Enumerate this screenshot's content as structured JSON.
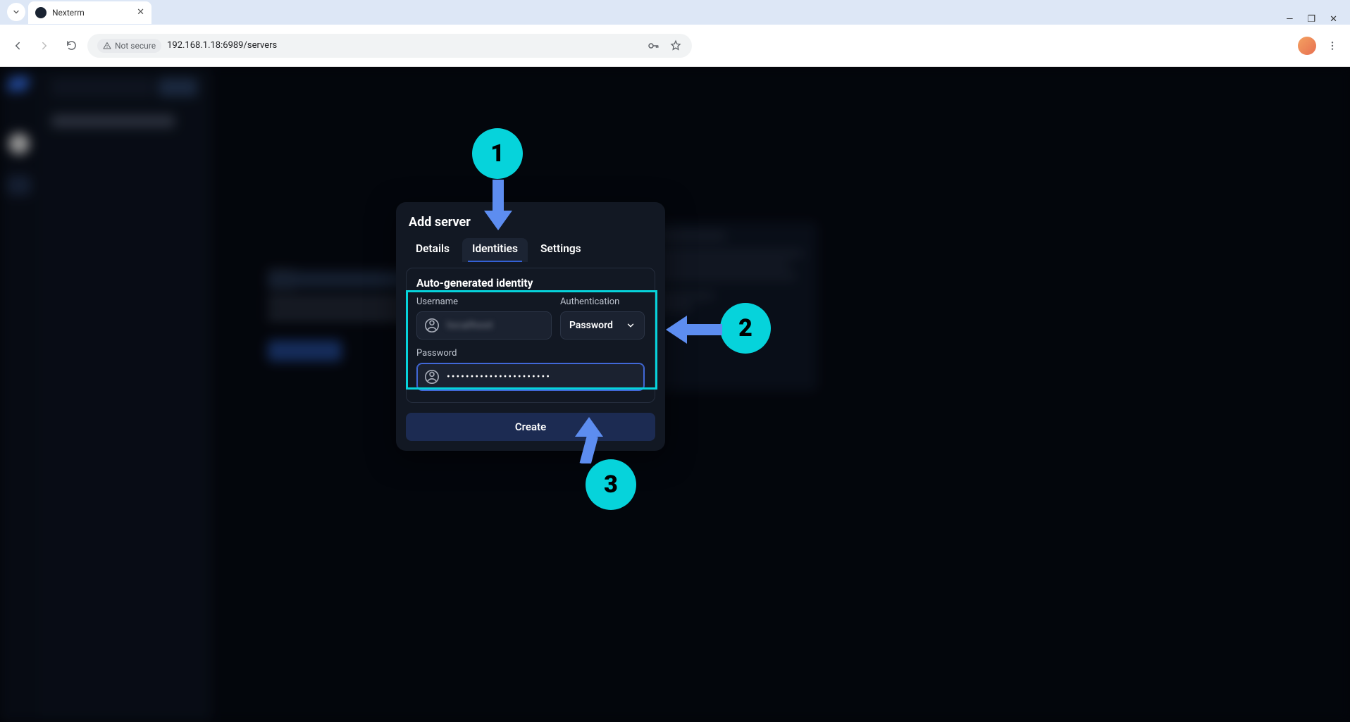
{
  "browser": {
    "tab_title": "Nexterm",
    "not_secure_label": "Not secure",
    "url": "192.168.1.18:6989/servers"
  },
  "modal": {
    "title": "Add server",
    "tabs": {
      "details": "Details",
      "identities": "Identities",
      "settings": "Settings"
    },
    "section_title": "Auto-generated identity",
    "labels": {
      "username": "Username",
      "authentication": "Authentication",
      "password": "Password"
    },
    "auth_selected": "Password",
    "username_value": "localhost",
    "password_value": "••••••••••••••••••••••",
    "create_label": "Create"
  },
  "annotations": {
    "step1": "1",
    "step2": "2",
    "step3": "3"
  },
  "colors": {
    "accent": "#06d3db",
    "primary_btn": "#1c2b52",
    "modal_bg": "#121823"
  }
}
